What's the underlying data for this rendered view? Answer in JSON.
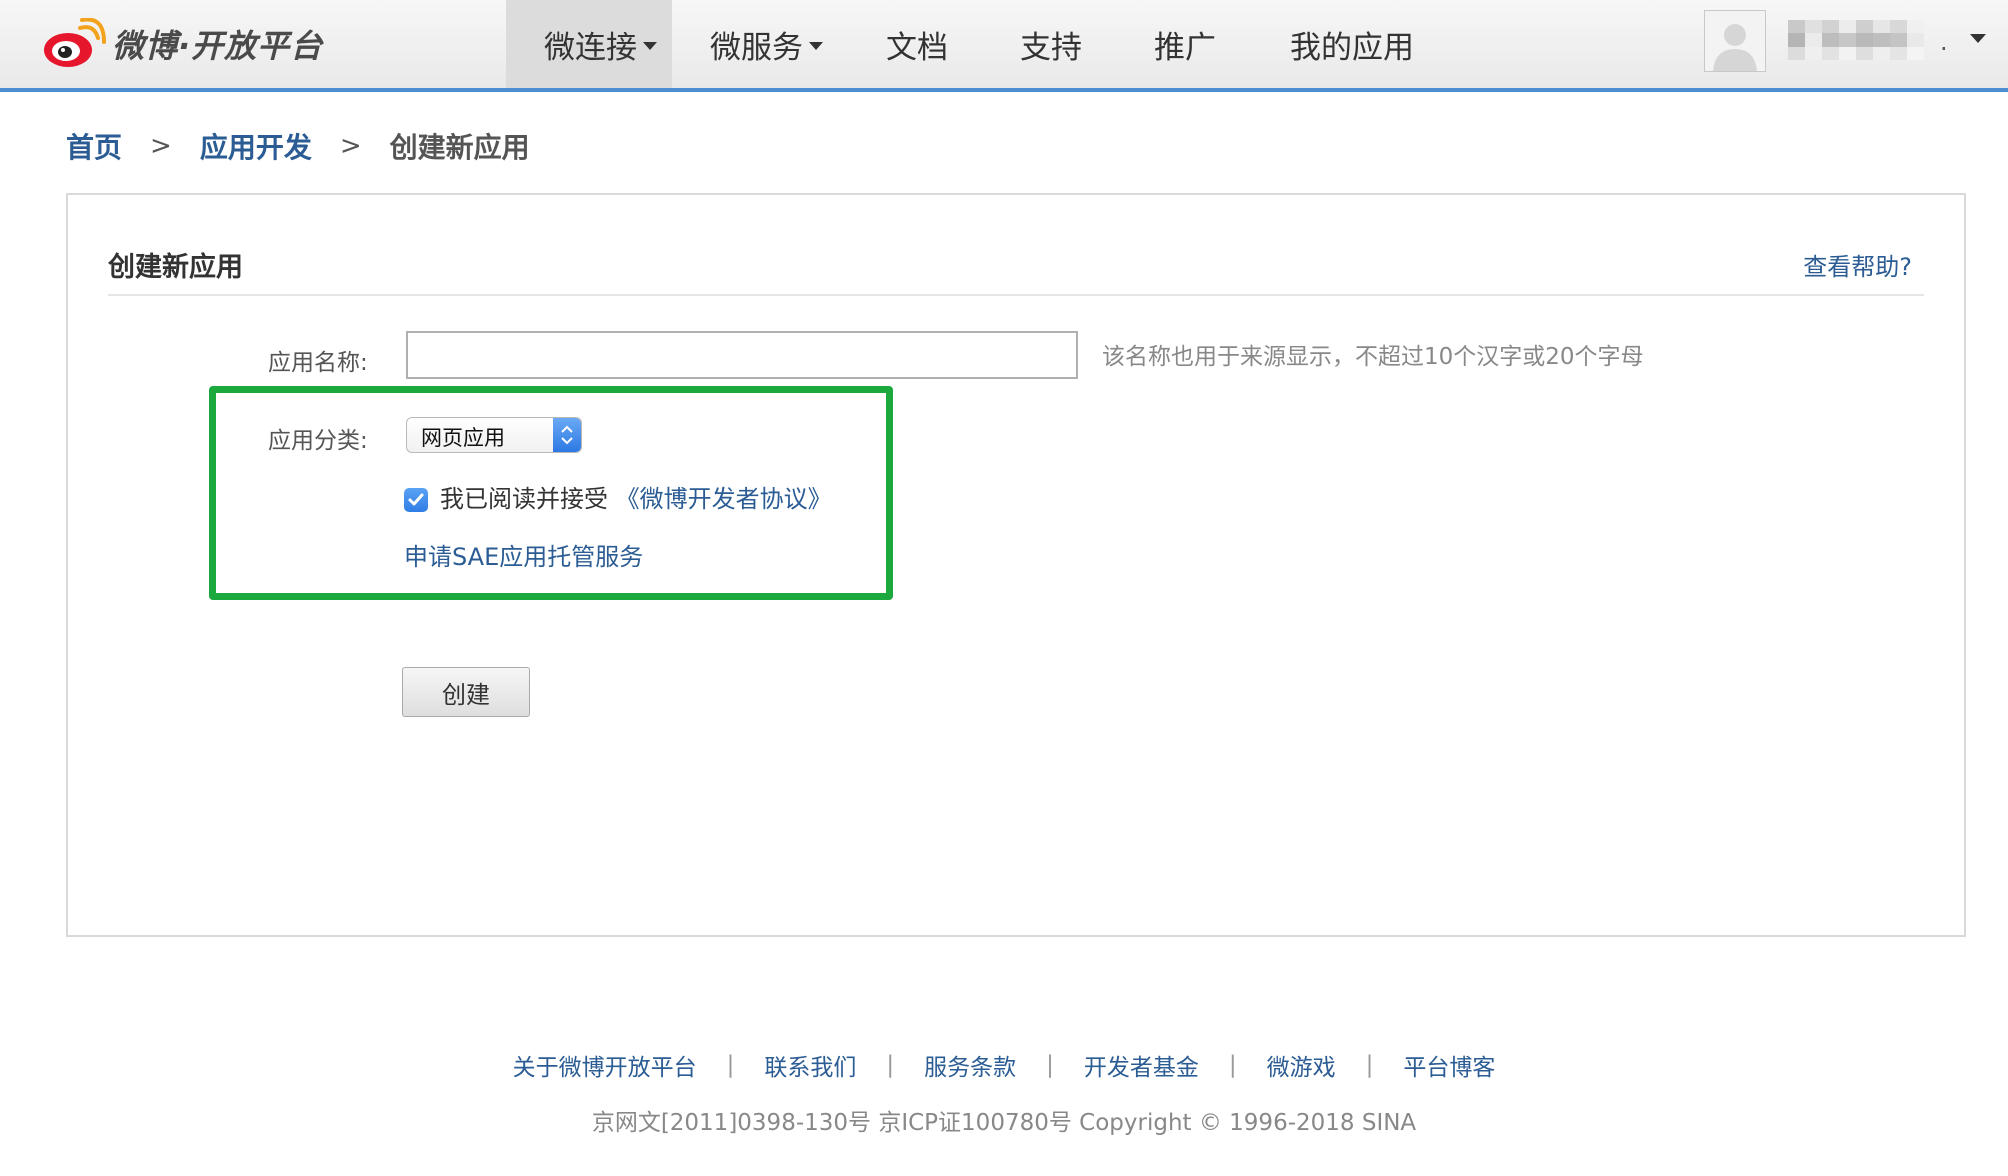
{
  "header": {
    "logo_text": "微博·开放平台",
    "nav": [
      {
        "label": "微连接",
        "has_dropdown": true,
        "active": true
      },
      {
        "label": "微服务",
        "has_dropdown": true,
        "active": false
      },
      {
        "label": "文档",
        "has_dropdown": false,
        "active": false
      },
      {
        "label": "支持",
        "has_dropdown": false,
        "active": false
      },
      {
        "label": "推广",
        "has_dropdown": false,
        "active": false
      },
      {
        "label": "我的应用",
        "has_dropdown": false,
        "active": false
      }
    ],
    "user_suffix": "."
  },
  "breadcrumb": {
    "home": "首页",
    "section": "应用开发",
    "separator": ">",
    "current": "创建新应用"
  },
  "panel": {
    "title": "创建新应用",
    "help_link": "查看帮助?"
  },
  "form": {
    "name_label": "应用名称:",
    "name_value": "",
    "name_hint": "该名称也用于来源显示，不超过10个汉字或20个字母",
    "category_label": "应用分类:",
    "category_value": "网页应用",
    "agree_checked": true,
    "agree_text": "我已阅读并接受",
    "agree_link": "《微博开发者协议》",
    "sae_link": "申请SAE应用托管服务",
    "submit_label": "创建"
  },
  "footer": {
    "links": [
      "关于微博开放平台",
      "联系我们",
      "服务条款",
      "开发者基金",
      "微游戏",
      "平台博客"
    ],
    "separator": "|",
    "copyright": "京网文[2011]0398-130号 京ICP证100780号 Copyright © 1996-2018 SINA"
  },
  "colors": {
    "link": "#2b5c94",
    "highlight_border": "#1ba83c",
    "header_border": "#4d8ed2",
    "checkbox": "#2f7de6"
  }
}
